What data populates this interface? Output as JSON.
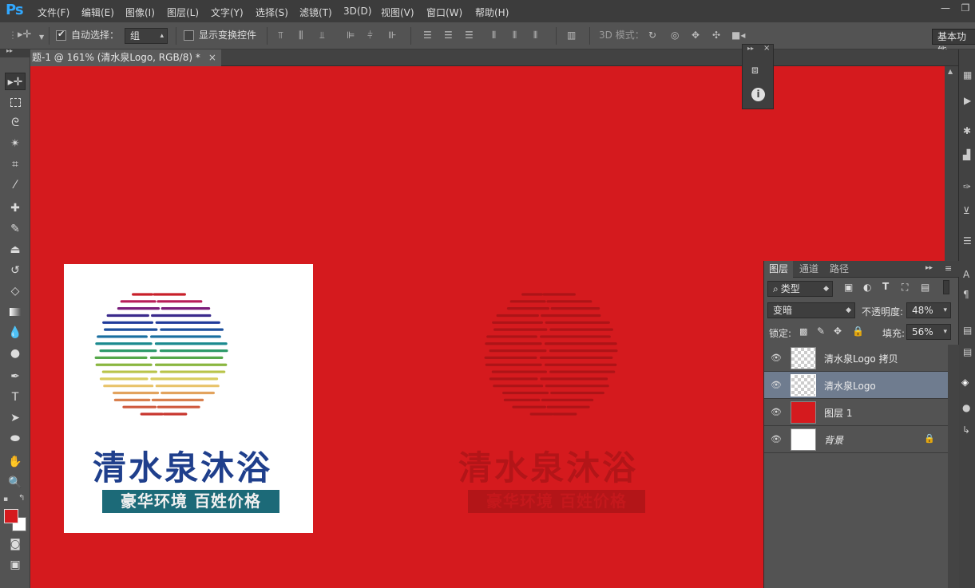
{
  "app": {
    "logo": "Ps"
  },
  "menu": [
    "文件(F)",
    "编辑(E)",
    "图像(I)",
    "图层(L)",
    "文字(Y)",
    "选择(S)",
    "滤镜(T)",
    "3D(D)",
    "视图(V)",
    "窗口(W)",
    "帮助(H)"
  ],
  "window_controls": {
    "minimize": "—",
    "restore": "❐"
  },
  "options_bar": {
    "auto_select_label": "自动选择：",
    "auto_select_checked": true,
    "auto_select_value": "组",
    "show_transform_label": "显示变换控件",
    "show_transform_checked": false,
    "mode_3d_label": "3D 模式：",
    "workspace": "基本功能"
  },
  "document_tab": {
    "title": "题-1 @ 161% (清水泉Logo, RGB/8) *",
    "close": "×"
  },
  "canvas": {
    "background": "#d51a1e"
  },
  "logo": {
    "title": "清水泉沐浴",
    "slogan": "豪华环境 百姓价格",
    "title_color": "#1f3f8c",
    "slogan_bg": "#1c6a78"
  },
  "layers_panel": {
    "tabs": [
      "图层",
      "通道",
      "路径"
    ],
    "filter_label": "类型",
    "blend_mode": "变暗",
    "opacity_label": "不透明度:",
    "opacity_value": "48%",
    "lock_label": "锁定:",
    "fill_label": "填充:",
    "fill_value": "56%",
    "layers": [
      {
        "name": "清水泉Logo 拷贝",
        "thumb": "checker",
        "selected": false
      },
      {
        "name": "清水泉Logo",
        "thumb": "checker",
        "selected": true
      },
      {
        "name": "图层 1",
        "thumb": "#d51a1e",
        "selected": false
      },
      {
        "name": "背景",
        "thumb": "#ffffff",
        "selected": false,
        "locked": true
      }
    ]
  },
  "colors": {
    "foreground": "#d51a1e",
    "background": "#ffffff",
    "accent": "#31a8ff"
  }
}
